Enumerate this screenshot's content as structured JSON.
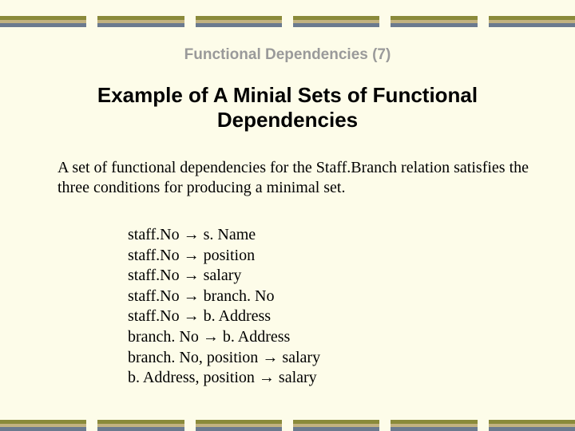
{
  "breadcrumb": "Functional Dependencies (7)",
  "title": "Example of A Minial Sets of Functional Dependencies",
  "body": "A set of functional dependencies for the Staff.Branch relation satisfies the three conditions for producing a minimal set.",
  "arrow": "→",
  "fds": [
    {
      "lhs": "staff.No",
      "rhs": "s. Name"
    },
    {
      "lhs": "staff.No",
      "rhs": "position"
    },
    {
      "lhs": "staff.No",
      "rhs": "salary"
    },
    {
      "lhs": "staff.No",
      "rhs": "branch. No"
    },
    {
      "lhs": "staff.No",
      "rhs": "b. Address"
    },
    {
      "lhs": "branch. No",
      "rhs": "b. Address"
    },
    {
      "lhs": "branch. No, position",
      "rhs": "salary"
    },
    {
      "lhs": "b. Address, position",
      "rhs": "salary"
    }
  ]
}
